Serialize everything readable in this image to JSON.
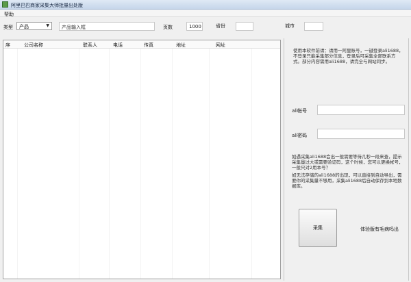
{
  "window": {
    "title": "阿里巴巴商家采集大师批量出处版"
  },
  "menu": {
    "help": "帮助"
  },
  "toolbar": {
    "type_label": "类型",
    "type_value": "产品",
    "keyword_value": "产品输入框",
    "pages_label": "页数",
    "pages_value": "1000",
    "province_label": "省份",
    "province_value": "",
    "city_label": "城市",
    "city_value": ""
  },
  "table": {
    "columns": [
      "序",
      "公司名称",
      "联系人",
      "电话",
      "传真",
      "地址",
      "网址"
    ]
  },
  "panel": {
    "intro": "使用本软件前请：请用一阿里账号，一键登录ali1688，不登录只能采集部分信息，登录后可采集全部联系方式。部分内容需用ali1688，请完全与网站同步。",
    "account_label": "ali帐号",
    "account_value": "",
    "password_label": "ali密码",
    "password_value": "",
    "note1": "如遇采集ali1688会出一般需要等待几秒一段来查，提示采集量过大或需要验证码，这个时候，您可以更换帐号，一般只对2用本号？",
    "note2": "如无法存储的ali1688的出现，可以直接到自动导出，需要你的采集量不够用，采集ali1688后自动保存到本地数据库。",
    "collect_button": "采集",
    "status": "体验版有毛病吗出"
  }
}
